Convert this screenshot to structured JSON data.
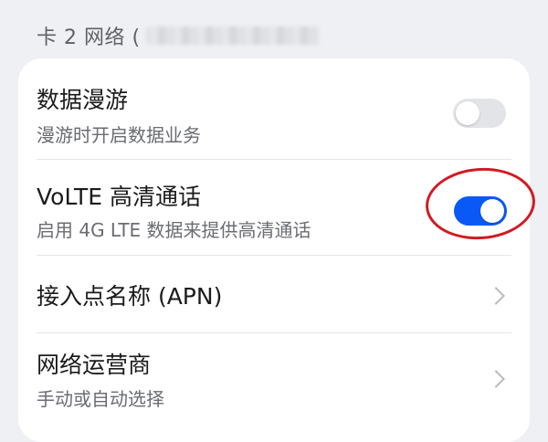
{
  "section": {
    "label": "卡 2 网络 ("
  },
  "settings": {
    "roaming": {
      "title": "数据漫游",
      "subtitle": "漫游时开启数据业务",
      "enabled": false
    },
    "volte": {
      "title": "VoLTE 高清通话",
      "subtitle": "启用 4G LTE 数据来提供高清通话",
      "enabled": true
    },
    "apn": {
      "title": "接入点名称 (APN)"
    },
    "operator": {
      "title": "网络运营商",
      "subtitle": "手动或自动选择"
    }
  },
  "colors": {
    "accent": "#0a59f7",
    "annotation": "#d11a22",
    "background": "#eef0f4",
    "card": "#ffffff"
  },
  "icons": {
    "chevron": "chevron-right-icon"
  }
}
